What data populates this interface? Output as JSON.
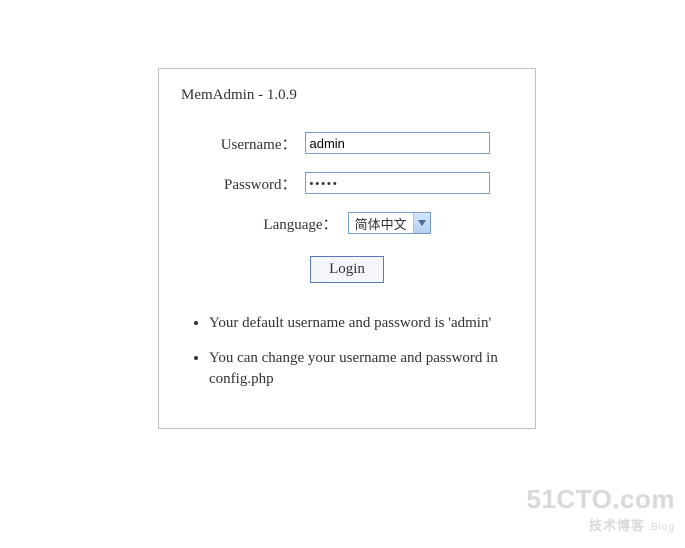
{
  "title": "MemAdmin - 1.0.9",
  "form": {
    "username_label": "Username：",
    "username_value": "admin",
    "password_label": "Password：",
    "password_value": "•••••",
    "language_label": "Language：",
    "language_value": "简体中文",
    "login_button": "Login"
  },
  "notes": [
    "Your default username and password is 'admin'",
    "You can change your username and password in config.php"
  ],
  "watermark": {
    "main": "51CTO.com",
    "sub": "技术博客",
    "blog": "Blog"
  }
}
